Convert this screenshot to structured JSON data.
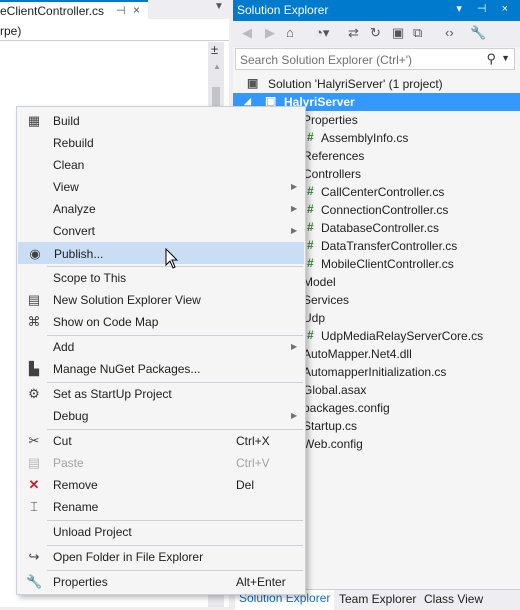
{
  "editor": {
    "tab_title": "eClientController.cs",
    "tab_pin": "⊣",
    "tab_close": "×",
    "dropdown_arrow": "▼",
    "type_combo": "rpe)",
    "split_icon": "±"
  },
  "solution_explorer": {
    "title": "Solution Explorer",
    "title_buttons": "▾ ⊣ ×",
    "search_placeholder": "Search Solution Explorer (Ctrl+')",
    "toolbar_icons": [
      "back-icon",
      "forward-icon",
      "home-icon",
      "sync-icon",
      "swap-icon",
      "refresh-icon",
      "collapse-icon",
      "copy-icon",
      "code-icon",
      "wrench-icon"
    ],
    "tree": [
      {
        "label": "Solution 'HalyriServer' (1 project)",
        "hash": false
      },
      {
        "label": "HalyriServer",
        "hash": false,
        "selected": true
      },
      {
        "label": "Properties",
        "hash": false
      },
      {
        "label": "AssemblyInfo.cs",
        "hash": true
      },
      {
        "label": "References",
        "hash": false
      },
      {
        "label": "Controllers",
        "hash": false
      },
      {
        "label": "CallCenterController.cs",
        "hash": true
      },
      {
        "label": "ConnectionController.cs",
        "hash": true
      },
      {
        "label": "DatabaseController.cs",
        "hash": true
      },
      {
        "label": "DataTransferController.cs",
        "hash": true
      },
      {
        "label": "MobileClientController.cs",
        "hash": true
      },
      {
        "label": "Model",
        "hash": false
      },
      {
        "label": "Services",
        "hash": false
      },
      {
        "label": "Udp",
        "hash": false
      },
      {
        "label": "UdpMediaRelayServerCore.cs",
        "hash": true
      },
      {
        "label": "AutoMapper.Net4.dll",
        "hash": false
      },
      {
        "label": "AutomapperInitialization.cs",
        "hash": false
      },
      {
        "label": "Global.asax",
        "hash": false
      },
      {
        "label": "packages.config",
        "hash": false
      },
      {
        "label": "Startup.cs",
        "hash": false
      },
      {
        "label": "Web.config",
        "hash": false
      }
    ],
    "bottom_tabs": [
      "Solution Explorer",
      "Team Explorer",
      "Class View"
    ]
  },
  "context_menu": {
    "items": [
      {
        "label": "Build",
        "icon": "build-icon"
      },
      {
        "label": "Rebuild"
      },
      {
        "label": "Clean"
      },
      {
        "label": "View",
        "submenu": true
      },
      {
        "label": "Analyze",
        "submenu": true
      },
      {
        "label": "Convert",
        "submenu": true
      },
      {
        "label": "Publish...",
        "icon": "publish-icon",
        "highlighted": true
      },
      {
        "label": "Scope to This"
      },
      {
        "label": "New Solution Explorer View",
        "icon": "new-view-icon"
      },
      {
        "label": "Show on Code Map",
        "icon": "code-map-icon"
      },
      {
        "label": "Add",
        "submenu": true
      },
      {
        "label": "Manage NuGet Packages...",
        "icon": "nuget-icon"
      },
      {
        "label": "Set as StartUp Project",
        "icon": "gear-icon"
      },
      {
        "label": "Debug",
        "submenu": true
      },
      {
        "label": "Cut",
        "icon": "cut-icon",
        "shortcut": "Ctrl+X"
      },
      {
        "label": "Paste",
        "icon": "paste-icon",
        "shortcut": "Ctrl+V",
        "disabled": true
      },
      {
        "label": "Remove",
        "icon": "remove-icon",
        "shortcut": "Del"
      },
      {
        "label": "Rename",
        "icon": "rename-icon"
      },
      {
        "label": "Unload Project"
      },
      {
        "label": "Open Folder in File Explorer",
        "icon": "open-folder-icon"
      },
      {
        "label": "Properties",
        "icon": "wrench-icon",
        "shortcut": "Alt+Enter"
      }
    ]
  },
  "colors": {
    "accent": "#007acc",
    "selection": "#3399ff",
    "menu_highlight": "#c9def5",
    "cs_file_hash": "#388a34",
    "remove_red": "#c8202a"
  }
}
